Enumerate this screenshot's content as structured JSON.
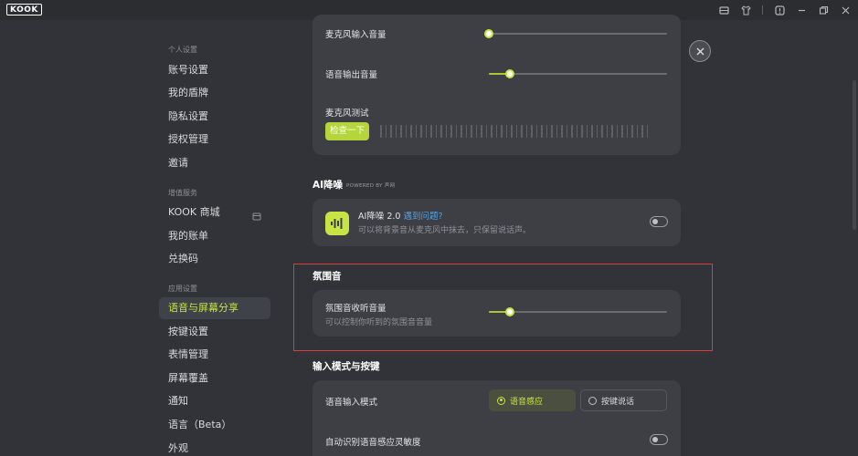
{
  "titlebar": {
    "logo": "KOOK"
  },
  "sidebar": {
    "sections": [
      {
        "label": "个人设置"
      },
      {
        "label": "增值服务"
      },
      {
        "label": "应用设置"
      }
    ],
    "items": [
      {
        "label": "账号设置"
      },
      {
        "label": "我的盾牌"
      },
      {
        "label": "隐私设置"
      },
      {
        "label": "授权管理"
      },
      {
        "label": "邀请"
      },
      {
        "label": "KOOK 商城"
      },
      {
        "label": "我的账单"
      },
      {
        "label": "兑换码"
      },
      {
        "label": "语音与屏幕分享"
      },
      {
        "label": "按键设置"
      },
      {
        "label": "表情管理"
      },
      {
        "label": "屏幕覆盖"
      },
      {
        "label": "通知"
      },
      {
        "label": "语言（Beta）"
      },
      {
        "label": "外观"
      }
    ]
  },
  "voice": {
    "mic_volume_label": "麦克风输入音量",
    "mic_volume": 0,
    "output_volume_label": "语音输出音量",
    "output_volume": 0.12,
    "mic_test_label": "麦克风测试",
    "check_button": "检查一下"
  },
  "ai": {
    "heading": "AI降噪",
    "powered_by": "POWERED BY 声网",
    "title": "AI降噪 2.0",
    "link": "遇到问题?",
    "description": "可以将背景音从麦克风中抹去，只保留说话声。",
    "enabled": false
  },
  "ambience": {
    "heading": "氛围音",
    "label": "氛围音收听音量",
    "description": "可以控制你听到的氛围音音量",
    "volume": 0.12
  },
  "input_mode": {
    "heading": "输入模式与按键",
    "label": "语音输入模式",
    "options": [
      {
        "label": "语音感应",
        "selected": true
      },
      {
        "label": "按键说话",
        "selected": false
      }
    ],
    "auto_label": "自动识别语音感应灵敏度",
    "auto_enabled": false
  },
  "colors": {
    "accent": "#c6e544",
    "highlight": "#e03a3a"
  }
}
